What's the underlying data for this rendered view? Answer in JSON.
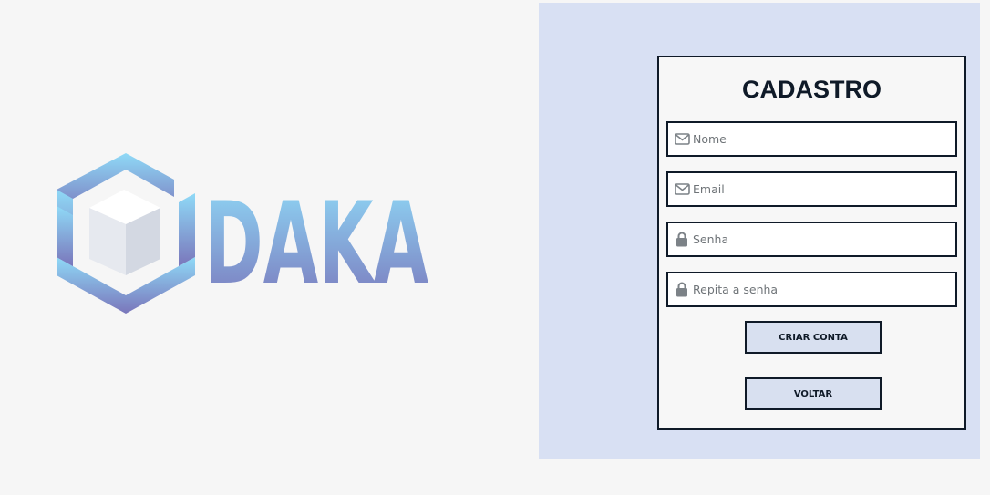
{
  "logo": {
    "text": "DAKA",
    "gradient_top": "#8fd6f5",
    "gradient_bottom": "#7a7bbd"
  },
  "form": {
    "title": "CADASTRO",
    "fields": [
      {
        "placeholder": "Nome",
        "value": "",
        "icon": "envelope-icon"
      },
      {
        "placeholder": "Email",
        "value": "",
        "icon": "envelope-icon"
      },
      {
        "placeholder": "Senha",
        "value": "",
        "icon": "lock-icon"
      },
      {
        "placeholder": "Repita a senha",
        "value": "",
        "icon": "lock-icon"
      }
    ],
    "create_button": "CRIAR CONTA",
    "back_button": "VOLTAR"
  },
  "colors": {
    "page_bg": "#f6f6f6",
    "panel_bg": "#d8e0f3",
    "border": "#0f1a28",
    "button_bg": "#d8e0f0",
    "icon": "#7c8287"
  }
}
